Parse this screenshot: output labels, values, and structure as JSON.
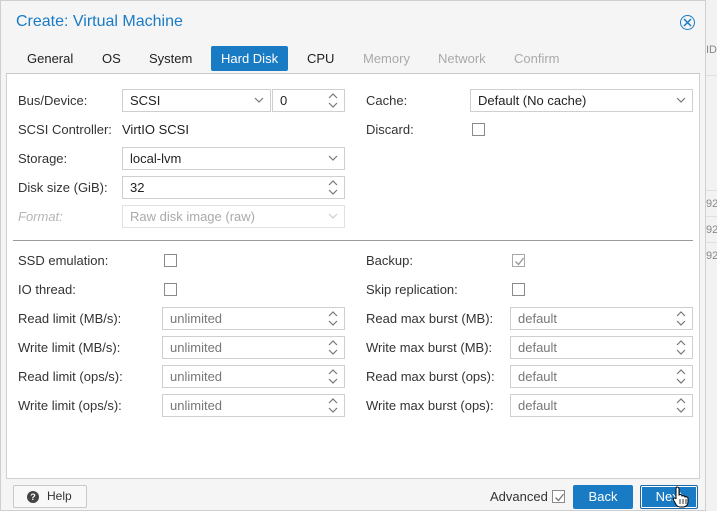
{
  "dialog": {
    "title": "Create: Virtual Machine",
    "close_icon": "close-circle-icon",
    "tabs": [
      {
        "label": "General",
        "state": "normal"
      },
      {
        "label": "OS",
        "state": "normal"
      },
      {
        "label": "System",
        "state": "normal"
      },
      {
        "label": "Hard Disk",
        "state": "active"
      },
      {
        "label": "CPU",
        "state": "normal"
      },
      {
        "label": "Memory",
        "state": "disabled"
      },
      {
        "label": "Network",
        "state": "disabled"
      },
      {
        "label": "Confirm",
        "state": "disabled"
      }
    ]
  },
  "form": {
    "bus_device": {
      "label": "Bus/Device:",
      "bus_value": "SCSI",
      "device_value": "0"
    },
    "scsi_controller": {
      "label": "SCSI Controller:",
      "value": "VirtIO SCSI"
    },
    "storage": {
      "label": "Storage:",
      "value": "local-lvm"
    },
    "disk_size": {
      "label": "Disk size (GiB):",
      "value": "32"
    },
    "format": {
      "label": "Format:",
      "value": "Raw disk image (raw)",
      "disabled": true
    },
    "cache": {
      "label": "Cache:",
      "value": "Default (No cache)"
    },
    "discard": {
      "label": "Discard:",
      "checked": false
    }
  },
  "advanced": {
    "ssd_emulation": {
      "label": "SSD emulation:",
      "checked": false
    },
    "io_thread": {
      "label": "IO thread:",
      "checked": false
    },
    "read_limit_mbs": {
      "label": "Read limit (MB/s):",
      "placeholder": "unlimited"
    },
    "write_limit_mbs": {
      "label": "Write limit (MB/s):",
      "placeholder": "unlimited"
    },
    "read_limit_ops": {
      "label": "Read limit (ops/s):",
      "placeholder": "unlimited"
    },
    "write_limit_ops": {
      "label": "Write limit (ops/s):",
      "placeholder": "unlimited"
    },
    "backup": {
      "label": "Backup:",
      "checked": true,
      "disabled": true
    },
    "skip_replication": {
      "label": "Skip replication:",
      "checked": false
    },
    "read_max_burst_mb": {
      "label": "Read max burst (MB):",
      "placeholder": "default"
    },
    "write_max_burst_mb": {
      "label": "Write max burst (MB):",
      "placeholder": "default"
    },
    "read_max_burst_ops": {
      "label": "Read max burst (ops):",
      "placeholder": "default"
    },
    "write_max_burst_ops": {
      "label": "Write max burst (ops):",
      "placeholder": "default"
    }
  },
  "footer": {
    "help_label": "Help",
    "help_icon": "question-circle-icon",
    "advanced_label": "Advanced",
    "advanced_checked": true,
    "back_label": "Back",
    "next_label": "Next"
  },
  "background": {
    "partial_texts": [
      "ID",
      "92",
      "92",
      "92"
    ]
  },
  "colors": {
    "accent": "#1a7bc5",
    "panel_bg": "#ffffff",
    "dialog_bg": "#f5f5f5",
    "disabled_text": "#aaaaaa"
  }
}
